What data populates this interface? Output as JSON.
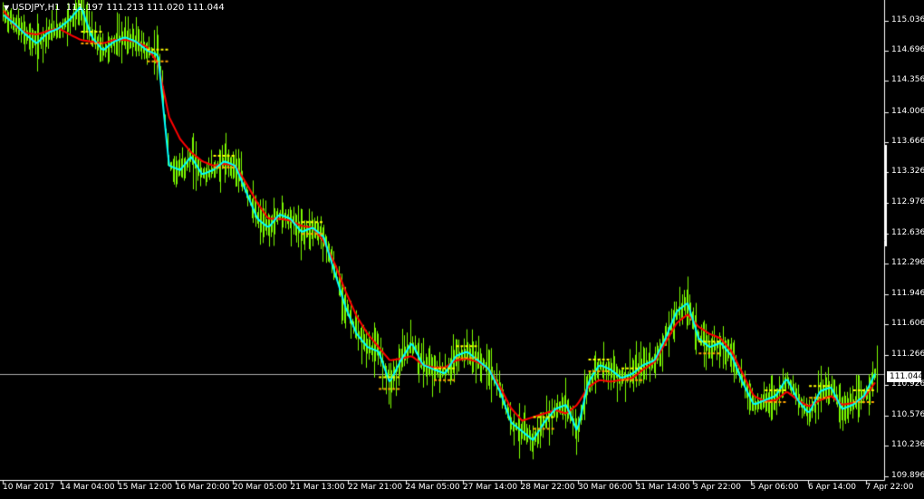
{
  "header": {
    "symbol": "USDJPY,H1",
    "ohlc": "111.197 111.213 111.020 111.044"
  },
  "current_price": "111.044",
  "colors": {
    "background": "#000000",
    "bars": "#7CFC00",
    "fast_ma": "#00FFFF",
    "slow_ma": "#FF0000",
    "marker_high": "#FFFF00",
    "marker_low": "#FFA500",
    "grid_axis": "#FFFFFF"
  },
  "chart_data": {
    "type": "line",
    "y_ticks": [
      "115.036",
      "114.696",
      "114.356",
      "114.006",
      "113.666",
      "113.326",
      "112.976",
      "112.636",
      "112.296",
      "111.946",
      "111.606",
      "111.266",
      "110.926",
      "110.576",
      "110.236",
      "109.896"
    ],
    "x_ticks": [
      "10 Mar 2017",
      "14 Mar 04:00",
      "15 Mar 12:00",
      "16 Mar 20:00",
      "20 Mar 05:00",
      "21 Mar 13:00",
      "22 Mar 21:00",
      "24 Mar 05:00",
      "27 Mar 14:00",
      "28 Mar 22:00",
      "30 Mar 06:00",
      "31 Mar 14:00",
      "3 Apr 22:00",
      "5 Apr 06:00",
      "6 Apr 14:00",
      "7 Apr 22:00"
    ],
    "ylim": [
      109.85,
      115.25
    ],
    "series": [
      {
        "values": [
          115.1,
          115.0,
          114.88,
          114.78,
          114.9,
          114.95,
          115.05,
          115.2,
          114.85,
          114.7,
          114.8,
          114.85,
          114.8,
          114.7,
          114.65,
          113.4,
          113.35,
          113.5,
          113.3,
          113.35,
          113.45,
          113.4,
          113.1,
          112.8,
          112.7,
          112.85,
          112.8,
          112.65,
          112.7,
          112.6,
          112.2,
          111.8,
          111.5,
          111.35,
          111.3,
          110.95,
          111.2,
          111.4,
          111.15,
          111.1,
          111.05,
          111.25,
          111.3,
          111.2,
          111.1,
          110.85,
          110.5,
          110.4,
          110.3,
          110.5,
          110.65,
          110.7,
          110.4,
          110.95,
          111.15,
          111.1,
          111.0,
          111.05,
          111.15,
          111.2,
          111.45,
          111.75,
          111.85,
          111.45,
          111.35,
          111.4,
          111.25,
          110.95,
          110.7,
          110.75,
          110.8,
          111.0,
          110.75,
          110.6,
          110.85,
          110.9,
          110.65,
          110.7,
          110.8,
          111.05
        ]
      },
      {
        "values": [
          115.15,
          114.98,
          114.9,
          114.88,
          114.92,
          114.95,
          114.88,
          114.82,
          114.8,
          114.78,
          114.82,
          114.82,
          114.8,
          114.74,
          114.55,
          113.95,
          113.7,
          113.55,
          113.45,
          113.4,
          113.42,
          113.4,
          113.2,
          112.98,
          112.8,
          112.8,
          112.78,
          112.72,
          112.7,
          112.55,
          112.3,
          111.98,
          111.7,
          111.5,
          111.35,
          111.2,
          111.22,
          111.25,
          111.15,
          111.12,
          111.12,
          111.2,
          111.22,
          111.18,
          111.1,
          110.9,
          110.66,
          110.52,
          110.56,
          110.6,
          110.64,
          110.6,
          110.7,
          110.9,
          110.98,
          110.96,
          110.98,
          111.0,
          111.1,
          111.18,
          111.4,
          111.62,
          111.72,
          111.58,
          111.5,
          111.45,
          111.3,
          111.05,
          110.8,
          110.74,
          110.75,
          110.85,
          110.75,
          110.68,
          110.75,
          110.8,
          110.7,
          110.72,
          110.78,
          110.95
        ]
      }
    ]
  }
}
